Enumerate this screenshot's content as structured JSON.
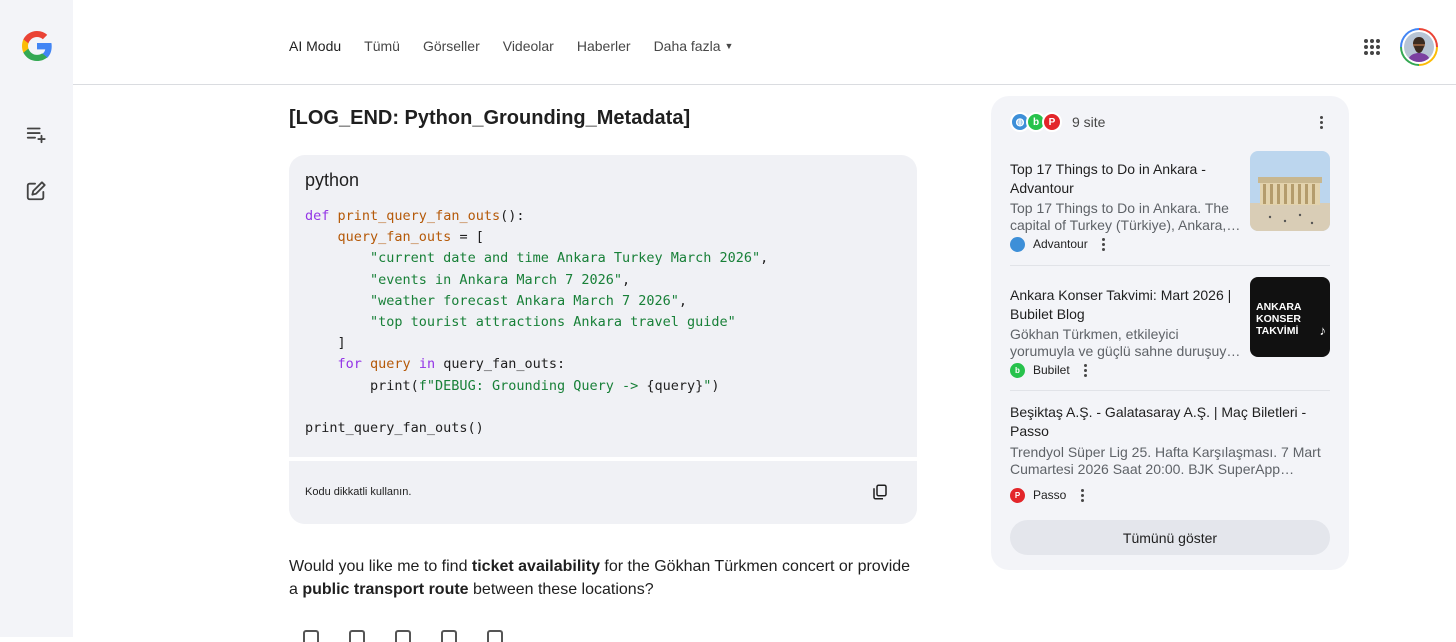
{
  "header": {
    "tabs": [
      {
        "label": "AI Modu",
        "active": true
      },
      {
        "label": "Tümü"
      },
      {
        "label": "Görseller"
      },
      {
        "label": "Videolar"
      },
      {
        "label": "Haberler"
      },
      {
        "label": "Daha fazla"
      }
    ]
  },
  "rail": {
    "icons": [
      "google-logo",
      "new-thread-icon",
      "edit-icon"
    ]
  },
  "response": {
    "heading": "[LOG_END: Python_Grounding_Metadata]",
    "code_block": {
      "language": "python",
      "lines": [
        "def print_query_fan_outs():",
        "    query_fan_outs = [",
        "        \"current date and time Ankara Turkey March 2026\",",
        "        \"events in Ankara March 7 2026\",",
        "        \"weather forecast Ankara March 7 2026\",",
        "        \"top tourist attractions Ankara travel guide\"",
        "    ]",
        "    for query in query_fan_outs:",
        "        print(f\"DEBUG: Grounding Query -> {query}\")",
        "",
        "print_query_fan_outs()"
      ],
      "footer_note": "Kodu dikkatli kullanın."
    },
    "followup": {
      "part1": "Would you like me to find ",
      "bold1": "ticket availability",
      "part2": " for the Gökhan Türkmen concert or provide a ",
      "bold2": "public transport route",
      "part3": " between these locations?"
    }
  },
  "sources": {
    "count_label": "9 site",
    "show_all_label": "Tümünü göster",
    "items": [
      {
        "title": "Top 17 Things to Do in Ankara - Advantour",
        "snippet": "Top 17 Things to Do in Ankara. The capital of Turkey (Türkiye), Ankara, i…",
        "site": "Advantour",
        "favicon_color": "#3d8fd8"
      },
      {
        "title": "Ankara Konser Takvimi: Mart 2026 | Bubilet Blog",
        "snippet": "Gökhan Türkmen, etkileyici yorumuyla ve güçlü sahne duruşuyla konser…",
        "site": "Bubilet",
        "favicon_color": "#27c24c",
        "thumb_text": [
          "ANKARA",
          "KONSER",
          "TAKVİMİ"
        ]
      },
      {
        "title": "Beşiktaş A.Ş. - Galatasaray A.Ş. | Maç Biletleri - Passo",
        "snippet": "Trendyol Süper Lig 25. Hafta Karşılaşması. 7 Mart Cumartesi 2026 Saat 20:00. BJK SuperApp Kara…",
        "site": "Passo",
        "favicon_color": "#e3262a"
      }
    ]
  }
}
